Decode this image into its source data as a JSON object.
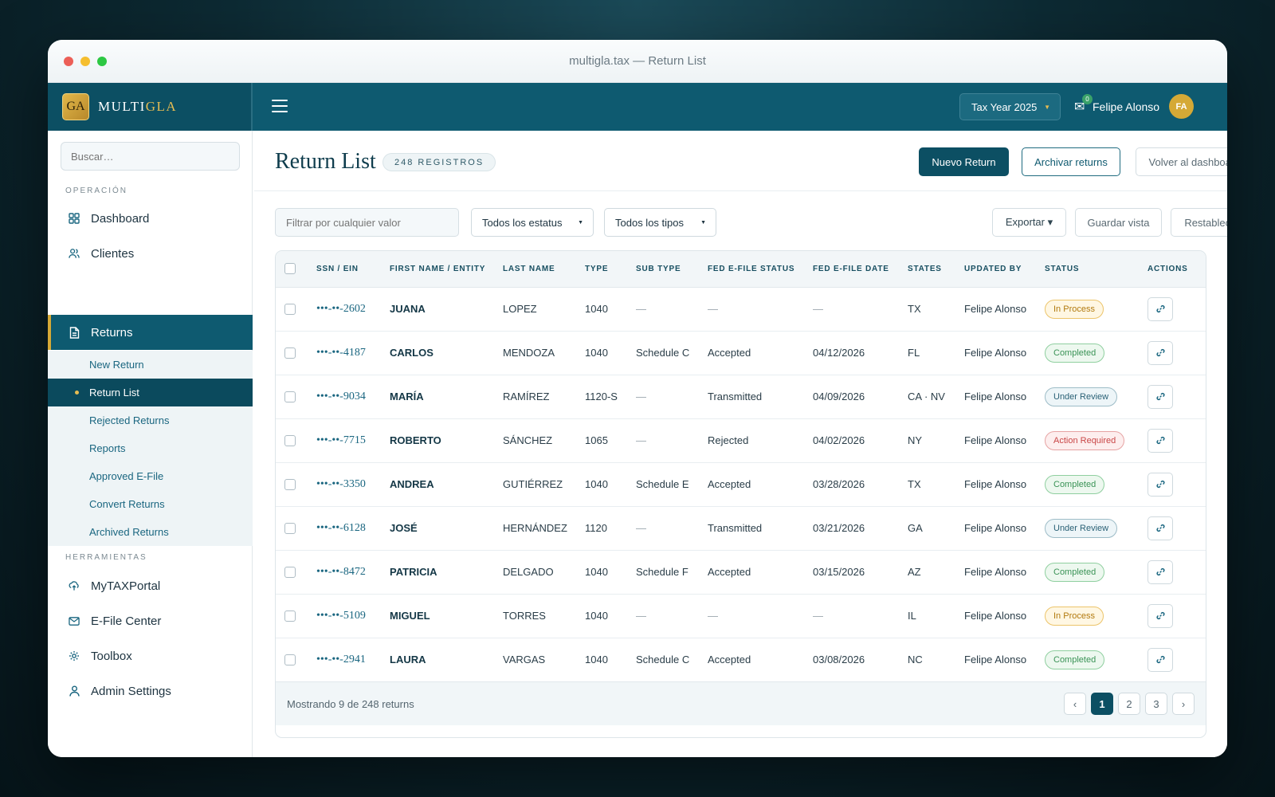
{
  "window": {
    "title": "multigla.tax — Return List"
  },
  "traffic_colors": [
    "#ec5f57",
    "#f5be2f",
    "#2dc843"
  ],
  "brand": {
    "logo_text": "GA",
    "name_prefix": "MULTI",
    "name_suffix": "GLA",
    "accent": "#e6bc52",
    "primary": "#0e5a70"
  },
  "header": {
    "tax_year": "Tax Year 2025",
    "mail_count": "0",
    "user_name": "Felipe Alonso",
    "user_initials": "FA"
  },
  "sidebar": {
    "search_placeholder": "Buscar…",
    "section_operacion": "OPERACIÓN",
    "section_herramientas": "HERRAMIENTAS",
    "items": [
      {
        "label": "Dashboard",
        "icon": "grid-icon"
      },
      {
        "label": "Clientes",
        "icon": "users-icon"
      },
      {
        "label": "Returns",
        "icon": "document-icon"
      }
    ],
    "sub_items": [
      {
        "label": "New Return"
      },
      {
        "label": "Return List"
      },
      {
        "label": "Rejected Returns"
      },
      {
        "label": "Reports"
      },
      {
        "label": "Approved E-File"
      },
      {
        "label": "Convert Returns"
      },
      {
        "label": "Archived Returns"
      }
    ],
    "tools": [
      {
        "label": "MyTAXPortal",
        "icon": "cloud-upload-icon"
      },
      {
        "label": "E-File Center",
        "icon": "mail-icon"
      },
      {
        "label": "Toolbox",
        "icon": "gear-icon"
      },
      {
        "label": "Admin Settings",
        "icon": "user-icon"
      }
    ]
  },
  "page": {
    "title": "Return List",
    "count_badge": "248 REGISTROS",
    "btn_new": "Nuevo Return",
    "btn_archive": "Archivar returns",
    "btn_back": "Volver al dashboard"
  },
  "filters": {
    "search_placeholder": "Filtrar por cualquier valor",
    "status_select": "Todos los estatus",
    "type_select": "Todos los tipos",
    "export": "Exportar ▾",
    "save_view": "Guardar vista",
    "reset": "Restablecer"
  },
  "table": {
    "columns": [
      "SSN / EIN",
      "FIRST NAME / ENTITY",
      "LAST NAME",
      "TYPE",
      "SUB TYPE",
      "FED E-FILE STATUS",
      "FED E-FILE DATE",
      "STATES",
      "UPDATED BY",
      "STATUS",
      "ACTIONS"
    ],
    "rows": [
      {
        "ssn": "•••-••-2602",
        "first": "JUANA",
        "last": "LOPEZ",
        "type": "1040",
        "sub": "—",
        "fed_status": "—",
        "fed_date": "—",
        "states": "TX",
        "updated": "Felipe Alonso",
        "status": "In Process",
        "status_kind": "progress"
      },
      {
        "ssn": "•••-••-4187",
        "first": "CARLOS",
        "last": "MENDOZA",
        "type": "1040",
        "sub": "Schedule C",
        "fed_status": "Accepted",
        "fed_date": "04/12/2026",
        "states": "FL",
        "updated": "Felipe Alonso",
        "status": "Completed",
        "status_kind": "completed"
      },
      {
        "ssn": "•••-••-9034",
        "first": "MARÍA",
        "last": "RAMÍREZ",
        "type": "1120-S",
        "sub": "—",
        "fed_status": "Transmitted",
        "fed_date": "04/09/2026",
        "states": "CA · NV",
        "updated": "Felipe Alonso",
        "status": "Under Review",
        "status_kind": "review"
      },
      {
        "ssn": "•••-••-7715",
        "first": "ROBERTO",
        "last": "SÁNCHEZ",
        "type": "1065",
        "sub": "—",
        "fed_status": "Rejected",
        "fed_date": "04/02/2026",
        "states": "NY",
        "updated": "Felipe Alonso",
        "status": "Action Required",
        "status_kind": "action"
      },
      {
        "ssn": "•••-••-3350",
        "first": "ANDREA",
        "last": "GUTIÉRREZ",
        "type": "1040",
        "sub": "Schedule E",
        "fed_status": "Accepted",
        "fed_date": "03/28/2026",
        "states": "TX",
        "updated": "Felipe Alonso",
        "status": "Completed",
        "status_kind": "completed"
      },
      {
        "ssn": "•••-••-6128",
        "first": "JOSÉ",
        "last": "HERNÁNDEZ",
        "type": "1120",
        "sub": "—",
        "fed_status": "Transmitted",
        "fed_date": "03/21/2026",
        "states": "GA",
        "updated": "Felipe Alonso",
        "status": "Under Review",
        "status_kind": "review"
      },
      {
        "ssn": "•••-••-8472",
        "first": "PATRICIA",
        "last": "DELGADO",
        "type": "1040",
        "sub": "Schedule F",
        "fed_status": "Accepted",
        "fed_date": "03/15/2026",
        "states": "AZ",
        "updated": "Felipe Alonso",
        "status": "Completed",
        "status_kind": "completed"
      },
      {
        "ssn": "•••-••-5109",
        "first": "MIGUEL",
        "last": "TORRES",
        "type": "1040",
        "sub": "—",
        "fed_status": "—",
        "fed_date": "—",
        "states": "IL",
        "updated": "Felipe Alonso",
        "status": "In Process",
        "status_kind": "progress"
      },
      {
        "ssn": "•••-••-2941",
        "first": "LAURA",
        "last": "VARGAS",
        "type": "1040",
        "sub": "Schedule C",
        "fed_status": "Accepted",
        "fed_date": "03/08/2026",
        "states": "NC",
        "updated": "Felipe Alonso",
        "status": "Completed",
        "status_kind": "completed"
      }
    ],
    "footer_text": "Mostrando 9 de 248 returns",
    "pager": {
      "prev": "‹",
      "pages": [
        "1",
        "2",
        "3"
      ],
      "next": "›"
    }
  }
}
